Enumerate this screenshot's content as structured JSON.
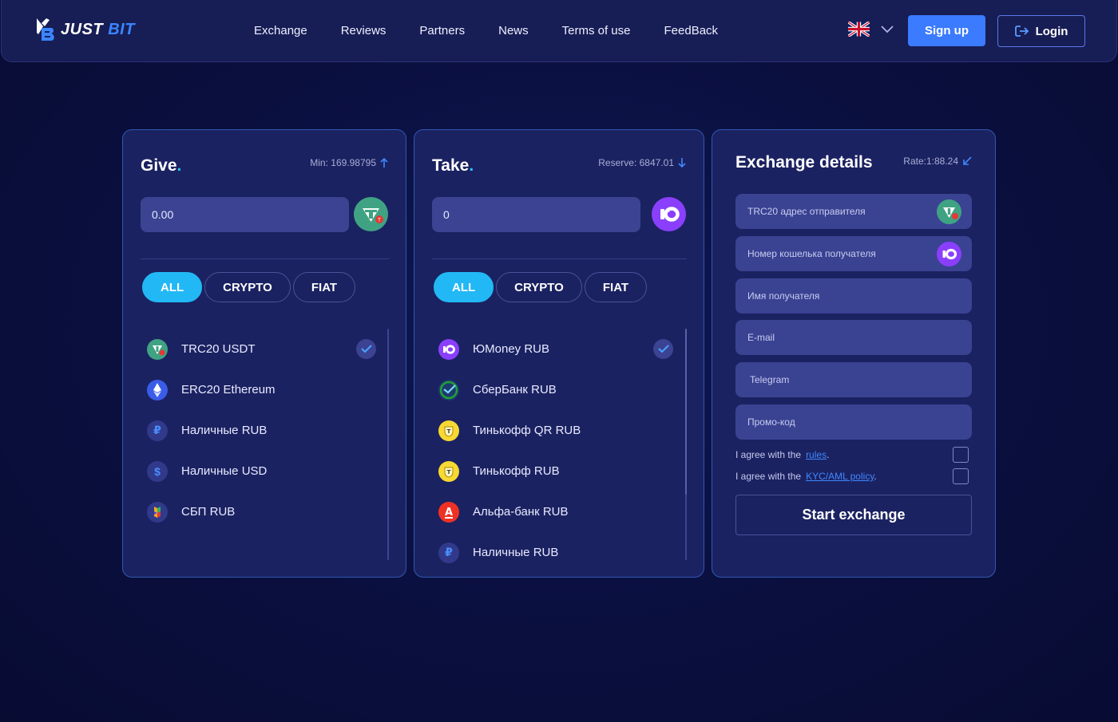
{
  "header": {
    "logo_just": "JUST",
    "logo_bit": "BIT",
    "nav": [
      "Exchange",
      "Reviews",
      "Partners",
      "News",
      "Terms of use",
      "FeedBack"
    ],
    "signup": "Sign up",
    "login": "Login",
    "language_icon": "uk-flag-icon"
  },
  "give": {
    "title": "Give",
    "dot": ".",
    "meta": "Min: 169.98795",
    "amount": "0.00",
    "filters": [
      "ALL",
      "CRYPTO",
      "FIAT"
    ],
    "items": [
      {
        "label": "TRC20 USDT",
        "icon": "tether-icon",
        "selected": true
      },
      {
        "label": "ERC20 Ethereum",
        "icon": "ethereum-icon"
      },
      {
        "label": "Наличные RUB",
        "icon": "ruble-icon"
      },
      {
        "label": "Наличные USD",
        "icon": "dollar-icon"
      },
      {
        "label": "СБП RUB",
        "icon": "sbp-icon"
      }
    ]
  },
  "take": {
    "title": "Take",
    "dot": ".",
    "meta": "Reserve: 6847.01",
    "amount": "0",
    "filters": [
      "ALL",
      "CRYPTO",
      "FIAT"
    ],
    "items": [
      {
        "label": "ЮMoney RUB",
        "icon": "yoomoney-icon",
        "selected": true
      },
      {
        "label": "СберБанк RUB",
        "icon": "sberbank-icon"
      },
      {
        "label": "Тинькофф QR RUB",
        "icon": "tinkoff-icon"
      },
      {
        "label": "Тинькофф RUB",
        "icon": "tinkoff-icon"
      },
      {
        "label": "Альфа-банк RUB",
        "icon": "alfabank-icon"
      },
      {
        "label": "Наличные RUB",
        "icon": "ruble-icon"
      }
    ]
  },
  "details": {
    "title": "Exchange details",
    "meta": "Rate:1:88.24",
    "fields": [
      "TRC20 адрес отправителя",
      "Номер кошелька получателя",
      "Имя получателя",
      "E-mail",
      "Telegram",
      "Промо-код"
    ],
    "agree_rules_text": "I agree with the",
    "agree_rules_link": "rules",
    "agree_kyc_text": "I agree with the",
    "agree_kyc_link": "KYC/AML policy",
    "period": ".",
    "start": "Start exchange"
  },
  "colors": {
    "accent": "#22b8f5",
    "primary_button": "#3a7bff",
    "panel": "#1b2261",
    "background": "#0a0f3e"
  }
}
